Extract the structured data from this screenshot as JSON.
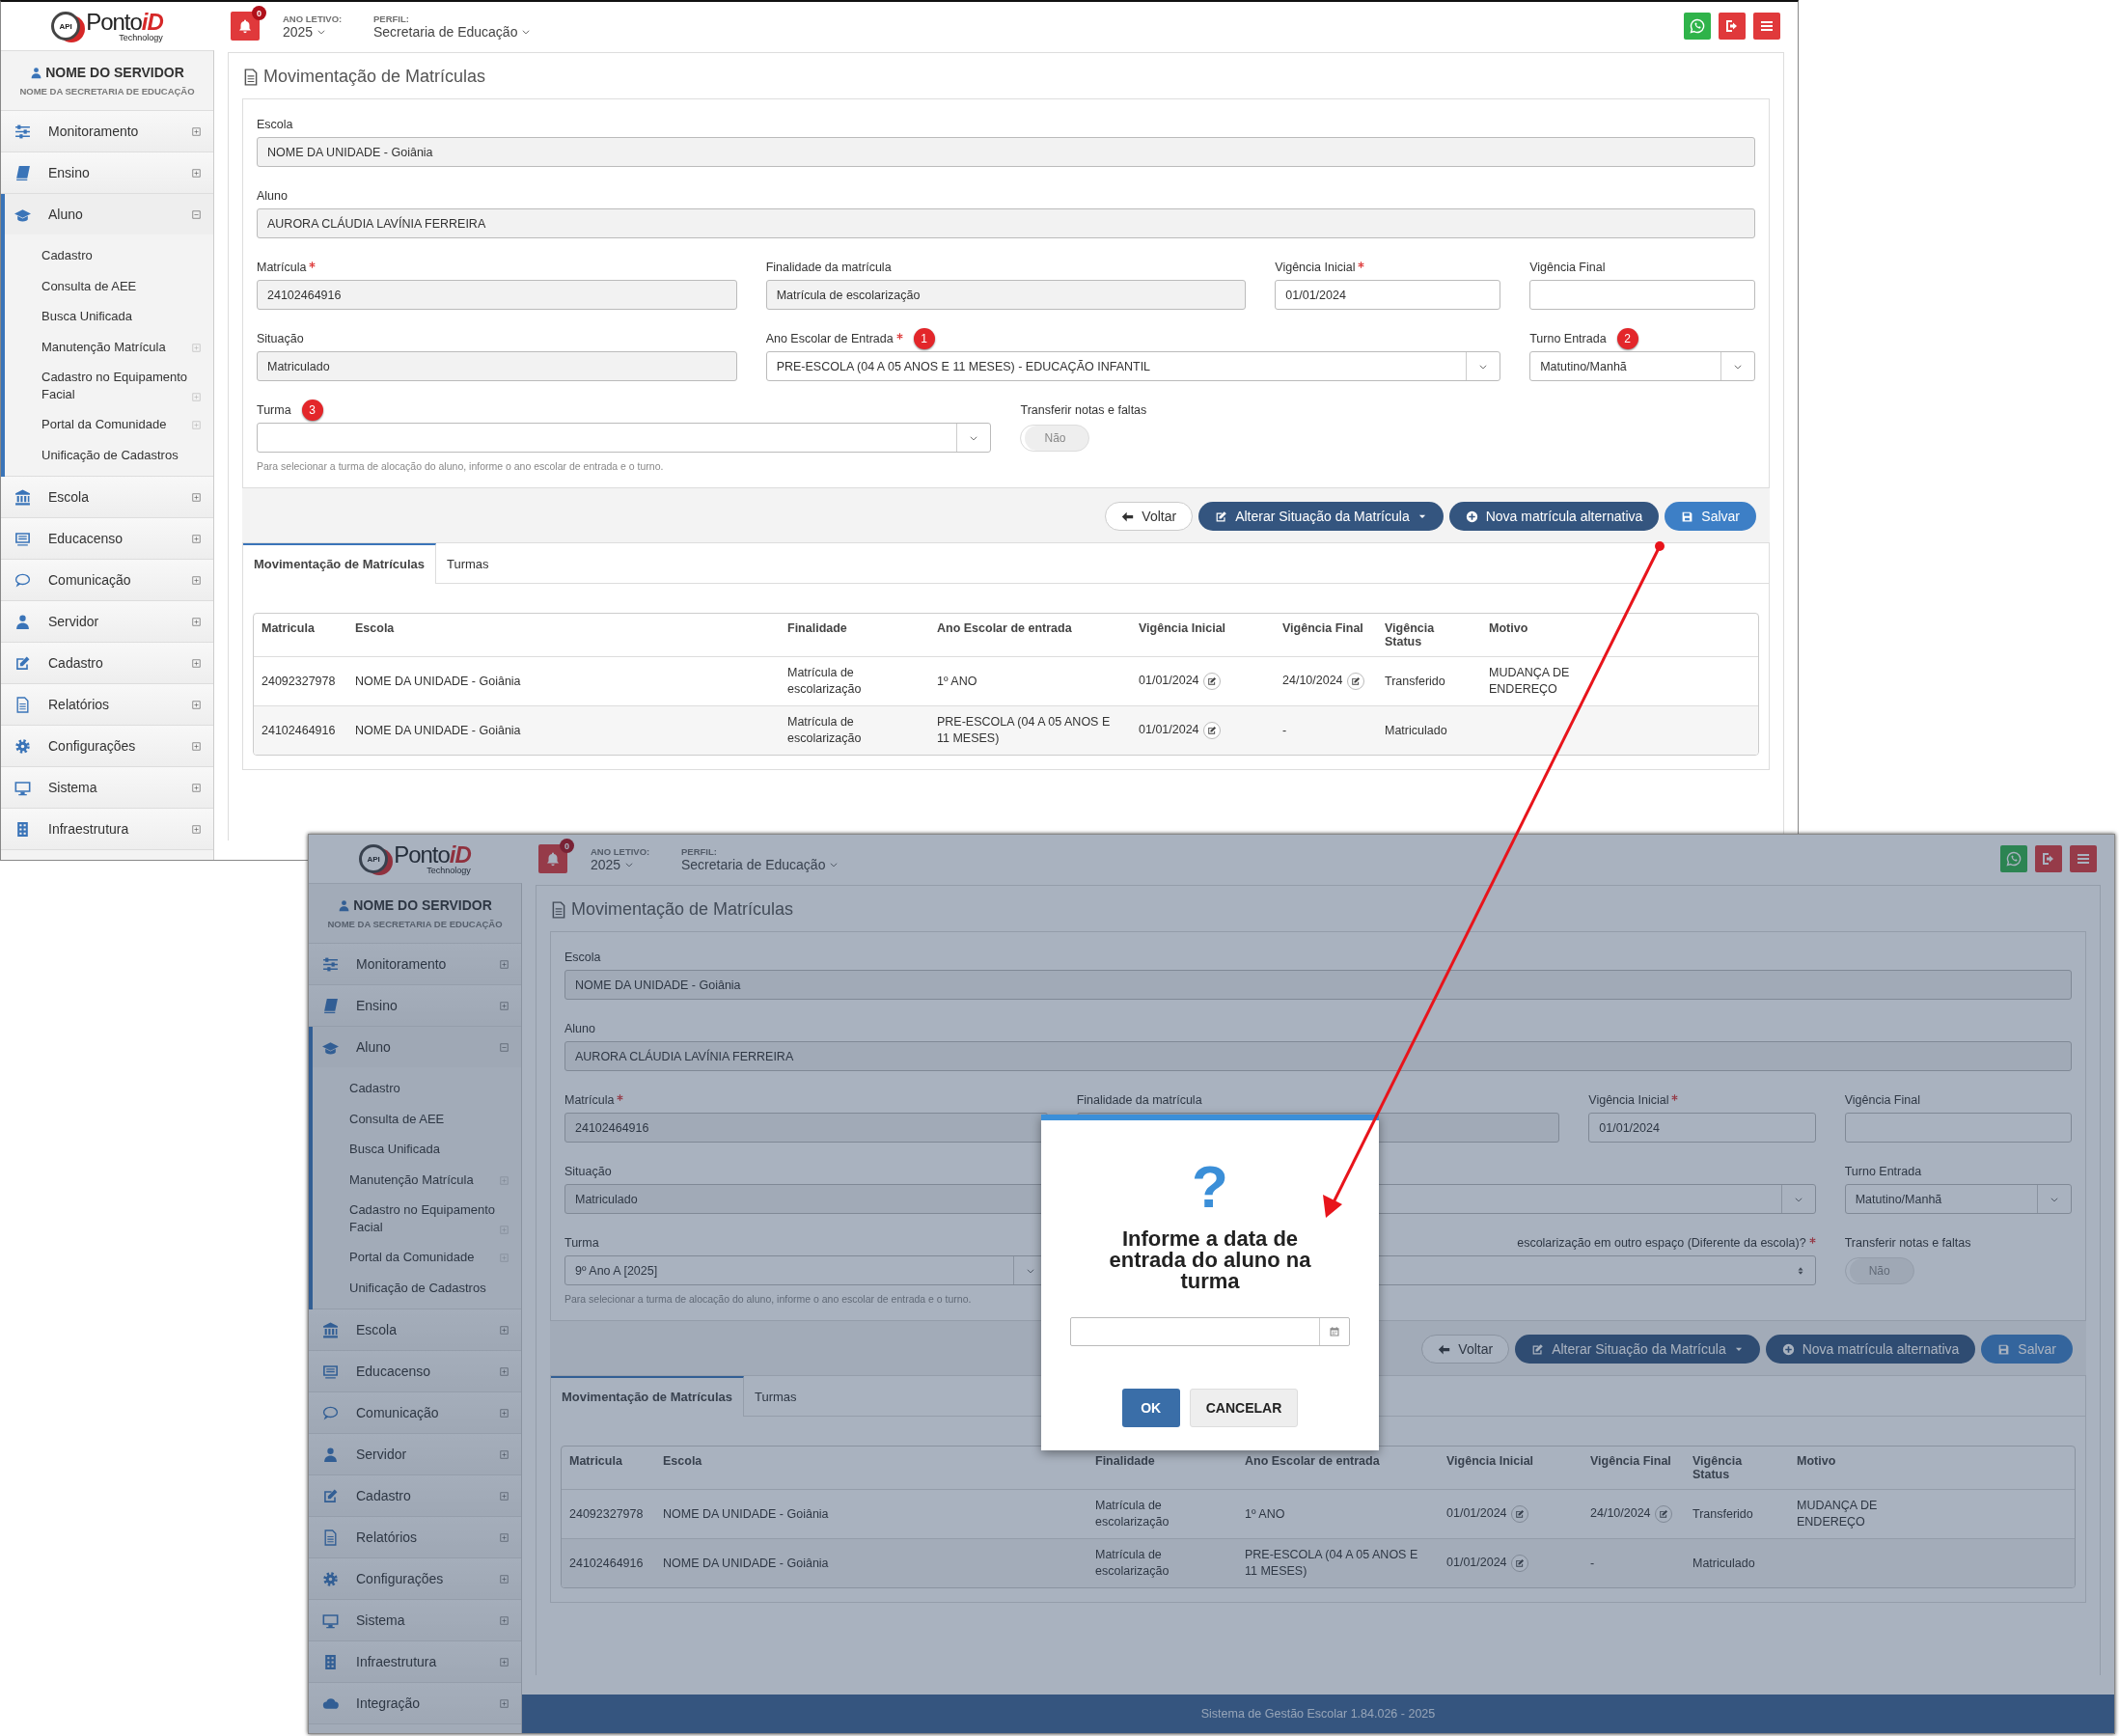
{
  "screens": [
    {
      "header": {
        "logo_mark": "API",
        "logo_text": "Ponto",
        "logo_accent": "iD",
        "logo_tagline": "Technology",
        "notifications": "0",
        "year_label": "ANO LETIVO:",
        "year": "2025",
        "profile_label": "PERFIL:",
        "profile": "Secretaria de Educação"
      },
      "user": {
        "name": "NOME DO SERVIDOR",
        "org": "NOME DA SECRETARIA DE EDUCAÇÃO"
      },
      "menu": [
        {
          "label": "Monitoramento",
          "kind": "sliders",
          "expanded": false
        },
        {
          "label": "Ensino",
          "kind": "book",
          "expanded": false
        },
        {
          "label": "Aluno",
          "kind": "graduation",
          "expanded": true,
          "children": [
            {
              "label": "Cadastro"
            },
            {
              "label": "Consulta de AEE"
            },
            {
              "label": "Busca Unificada"
            },
            {
              "label": "Manutenção Matrícula",
              "expanded": false
            },
            {
              "label": "Cadastro no Equipamento Facial",
              "expanded": false
            },
            {
              "label": "Portal da Comunidade",
              "expanded": false
            },
            {
              "label": "Unificação de Cadastros"
            }
          ]
        },
        {
          "label": "Escola",
          "kind": "bank",
          "expanded": false
        },
        {
          "label": "Educacenso",
          "kind": "screen",
          "expanded": false
        },
        {
          "label": "Comunicação",
          "kind": "chat",
          "expanded": false
        },
        {
          "label": "Servidor",
          "kind": "person",
          "expanded": false
        },
        {
          "label": "Cadastro",
          "kind": "edit",
          "expanded": false
        },
        {
          "label": "Relatórios",
          "kind": "document",
          "expanded": false
        },
        {
          "label": "Configurações",
          "kind": "gear",
          "expanded": false
        },
        {
          "label": "Sistema",
          "kind": "monitor",
          "expanded": false
        },
        {
          "label": "Infraestrutura",
          "kind": "building",
          "expanded": false
        }
      ],
      "title": "Movimentação de Matrículas",
      "form": [
        [
          {
            "label": "Escola",
            "kind": "readonly",
            "value": "NOME DA UNIDADE - Goiânia"
          }
        ],
        [
          {
            "label": "Aluno",
            "kind": "readonly",
            "value": "AURORA CLÁUDIA LAVÍNIA FERREIRA"
          }
        ],
        [
          {
            "label": "Matrícula",
            "required": true,
            "kind": "readonly",
            "value": "24102464916"
          },
          {
            "label": "Finalidade da matrícula",
            "kind": "readonly",
            "value": "Matrícula de escolarização"
          },
          {
            "label": "Vigência Inicial",
            "required": true,
            "kind": "input",
            "value": "01/01/2024"
          },
          {
            "label": "Vigência Final",
            "kind": "input"
          }
        ],
        [
          {
            "label": "Situação",
            "kind": "readonly",
            "value": "Matriculado"
          },
          {
            "label": "Ano Escolar de Entrada",
            "required": true,
            "marker": "1",
            "kind": "select",
            "value": "PRE-ESCOLA (04 A 05 ANOS E 11 MESES) - EDUCAÇÃO INFANTIL"
          },
          {
            "label": "Turno Entrada",
            "marker": "2",
            "kind": "select",
            "value": "Matutino/Manhã"
          }
        ],
        [
          {
            "label": "Turma",
            "marker": "3",
            "kind": "select",
            "hint": "Para selecionar a turma de alocação do aluno, informe o ano escolar de entrada e o turno."
          },
          {
            "label": "Transferir notas e faltas",
            "kind": "switch",
            "value": "Não",
            "on": false
          }
        ]
      ],
      "buttons": [
        {
          "label": "Voltar",
          "kind": "default"
        },
        {
          "label": "Alterar Situação da Matrícula",
          "kind": "dark",
          "dropdown": true
        },
        {
          "label": "Nova matrícula alternativa",
          "kind": "dark"
        },
        {
          "label": "Salvar",
          "kind": "primary"
        }
      ],
      "tabs": [
        {
          "label": "Movimentação de Matrículas",
          "selected": true
        },
        {
          "label": "Turmas",
          "selected": false
        }
      ],
      "table": {
        "columns": [
          "Matricula",
          "Escola",
          "Finalidade",
          "Ano Escolar de entrada",
          "Vigência Inicial",
          "Vigência Final",
          "Vigência Status",
          "Motivo"
        ],
        "rows": [
          {
            "cells": [
              {
                "text": "24092327978"
              },
              {
                "text": "NOME DA UNIDADE - Goiânia"
              },
              {
                "text": "Matrícula de escolarização"
              },
              {
                "text": "1º ANO"
              },
              {
                "text": "01/01/2024",
                "edit": true
              },
              {
                "text": "24/10/2024",
                "edit": true
              },
              {
                "text": "Transferido"
              },
              {
                "text": "MUDANÇA DE ENDEREÇO"
              }
            ]
          },
          {
            "cells": [
              {
                "text": "24102464916"
              },
              {
                "text": "NOME DA UNIDADE - Goiânia"
              },
              {
                "text": "Matrícula de escolarização"
              },
              {
                "text": "PRE-ESCOLA (04 A 05 ANOS E 11 MESES)"
              },
              {
                "text": "01/01/2024",
                "edit": true
              },
              {
                "text": "-",
                "edit": false
              },
              {
                "text": "Matriculado"
              }
            ]
          }
        ]
      }
    },
    {
      "header": {
        "logo_mark": "API",
        "logo_text": "Ponto",
        "logo_accent": "iD",
        "logo_tagline": "Technology",
        "notifications": "0",
        "year_label": "ANO LETIVO:",
        "year": "2025",
        "profile_label": "PERFIL:",
        "profile": "Secretaria de Educação"
      },
      "user": {
        "name": "NOME DO SERVIDOR",
        "org": "NOME DA SECRETARIA DE EDUCAÇÃO"
      },
      "menu": [
        {
          "label": "Monitoramento",
          "kind": "sliders",
          "expanded": false
        },
        {
          "label": "Ensino",
          "kind": "book",
          "expanded": false
        },
        {
          "label": "Aluno",
          "kind": "graduation",
          "expanded": true,
          "children": [
            {
              "label": "Cadastro"
            },
            {
              "label": "Consulta de AEE"
            },
            {
              "label": "Busca Unificada"
            },
            {
              "label": "Manutenção Matrícula",
              "expanded": false
            },
            {
              "label": "Cadastro no Equipamento Facial",
              "expanded": false
            },
            {
              "label": "Portal da Comunidade",
              "expanded": false
            },
            {
              "label": "Unificação de Cadastros"
            }
          ]
        },
        {
          "label": "Escola",
          "kind": "bank",
          "expanded": false
        },
        {
          "label": "Educacenso",
          "kind": "screen",
          "expanded": false
        },
        {
          "label": "Comunicação",
          "kind": "chat",
          "expanded": false
        },
        {
          "label": "Servidor",
          "kind": "person",
          "expanded": false
        },
        {
          "label": "Cadastro",
          "kind": "edit",
          "expanded": false
        },
        {
          "label": "Relatórios",
          "kind": "document",
          "expanded": false
        },
        {
          "label": "Configurações",
          "kind": "gear",
          "expanded": false
        },
        {
          "label": "Sistema",
          "kind": "monitor",
          "expanded": false
        },
        {
          "label": "Infraestrutura",
          "kind": "building",
          "expanded": false
        },
        {
          "label": "Integração",
          "kind": "cloud",
          "expanded": false
        }
      ],
      "title": "Movimentação de Matrículas",
      "form": [
        [
          {
            "label": "Escola",
            "kind": "readonly",
            "value": "NOME DA UNIDADE - Goiânia"
          }
        ],
        [
          {
            "label": "Aluno",
            "kind": "readonly",
            "value": "AURORA CLÁUDIA LAVÍNIA FERREIRA"
          }
        ],
        [
          {
            "label": "Matrícula",
            "required": true,
            "kind": "readonly",
            "value": "24102464916"
          },
          {
            "label": "Finalidade da matrícula",
            "kind": "readonly"
          },
          {
            "label": "Vigência Inicial",
            "required": true,
            "kind": "input",
            "value": "01/01/2024"
          },
          {
            "label": "Vigência Final",
            "kind": "input"
          }
        ],
        [
          {
            "label": "Situação",
            "kind": "readonly",
            "value": "Matriculado"
          },
          {
            "kind": "select"
          },
          {
            "label": "Turno Entrada",
            "kind": "select",
            "value": "Matutino/Manhã"
          }
        ],
        [
          {
            "label": "Turma",
            "kind": "select",
            "value": "9º Ano A [2025]",
            "hint": "Para selecionar a turma de alocação do aluno, informe o ano escolar de entrada e o turno."
          },
          {
            "label": "escolarização em outro espaço (Diferente da escola)?",
            "required": true,
            "kind": "spinner"
          },
          {
            "label": "Transferir notas e faltas",
            "kind": "switch",
            "value": "Não",
            "on": false
          }
        ]
      ],
      "buttons": [
        {
          "label": "Voltar",
          "kind": "default"
        },
        {
          "label": "Alterar Situação da Matrícula",
          "kind": "dark",
          "dropdown": true
        },
        {
          "label": "Nova matrícula alternativa",
          "kind": "dark"
        },
        {
          "label": "Salvar",
          "kind": "primary"
        }
      ],
      "tabs": [
        {
          "label": "Movimentação de Matrículas",
          "selected": true
        },
        {
          "label": "Turmas",
          "selected": false
        }
      ],
      "table": {
        "columns": [
          "Matricula",
          "Escola",
          "Finalidade",
          "Ano Escolar de entrada",
          "Vigência Inicial",
          "Vigência Final",
          "Vigência Status",
          "Motivo"
        ],
        "rows": [
          {
            "cells": [
              {
                "text": "24092327978"
              },
              {
                "text": "NOME DA UNIDADE - Goiânia"
              },
              {
                "text": "Matrícula de escolarização"
              },
              {
                "text": "1º ANO"
              },
              {
                "text": "01/01/2024",
                "edit": true
              },
              {
                "text": "24/10/2024",
                "edit": true
              },
              {
                "text": "Transferido"
              },
              {
                "text": "MUDANÇA DE ENDEREÇO"
              }
            ]
          },
          {
            "cells": [
              {
                "text": "24102464916"
              },
              {
                "text": "NOME DA UNIDADE - Goiânia"
              },
              {
                "text": "Matrícula de escolarização"
              },
              {
                "text": "PRE-ESCOLA (04 A 05 ANOS E 11 MESES)"
              },
              {
                "text": "01/01/2024",
                "edit": true
              },
              {
                "text": "-",
                "edit": false
              },
              {
                "text": "Matriculado"
              }
            ]
          }
        ]
      },
      "footer": "Sistema de Gestão Escolar 1.84.026 - 2025",
      "dialog": {
        "icon": "?",
        "title": "Informe a data de entrada do aluno na turma",
        "buttons": [
          {
            "label": "OK",
            "kind": "primary"
          },
          {
            "label": "CANCELAR",
            "kind": "default"
          }
        ]
      }
    }
  ]
}
